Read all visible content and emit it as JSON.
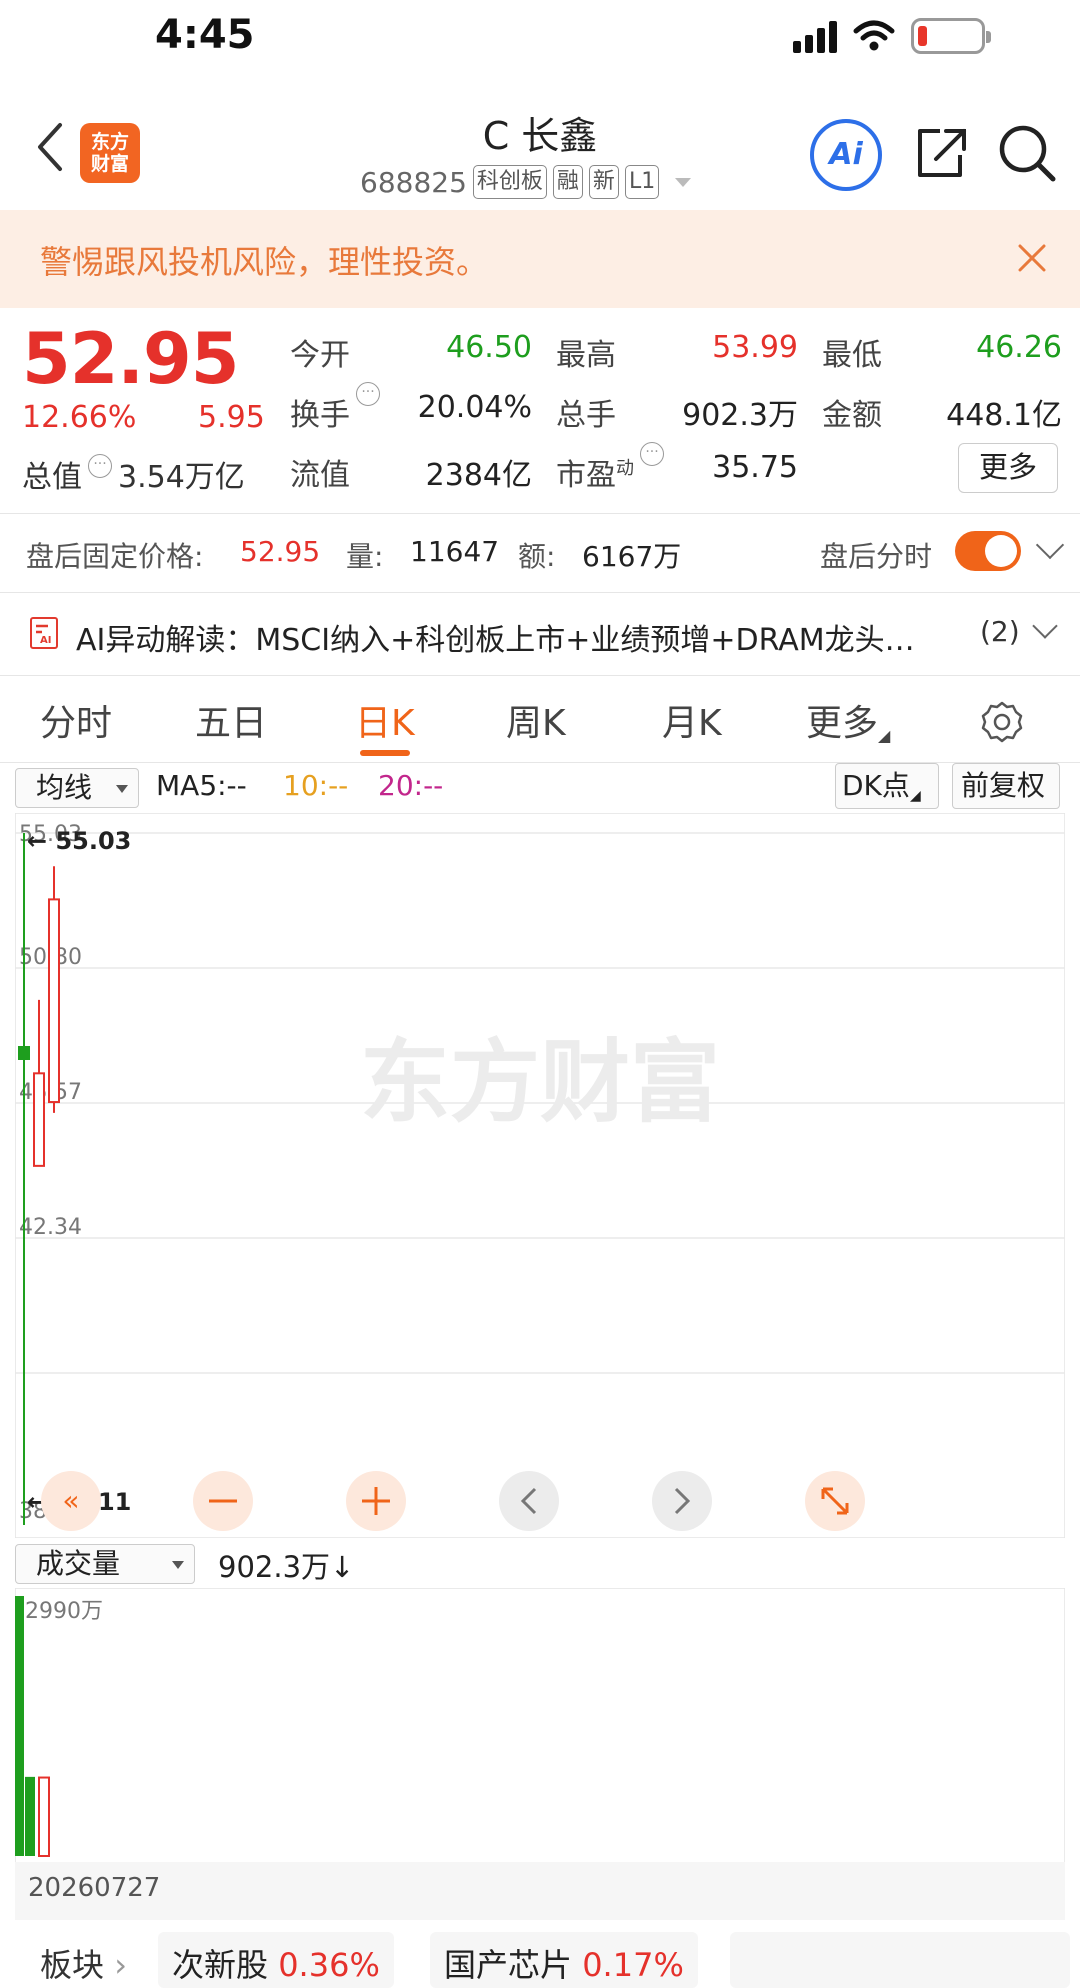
{
  "status_bar": {
    "time": "4:45"
  },
  "header": {
    "logo_text": "东方财富",
    "stock_name": "C 长鑫",
    "stock_code": "688825",
    "tags": [
      "科创板",
      "融",
      "新",
      "L1"
    ],
    "ai_label": "Ai"
  },
  "warning": {
    "text": "警惕跟风投机风险，理性投资。"
  },
  "quote": {
    "price": "52.95",
    "change_pct": "12.66%",
    "change": "5.95",
    "total_value_label": "总值",
    "total_value": "3.54万亿",
    "fields": [
      {
        "label": "今开",
        "value": "46.50",
        "color": "green"
      },
      {
        "label": "最高",
        "value": "53.99",
        "color": "red"
      },
      {
        "label": "最低",
        "value": "46.26",
        "color": "green"
      },
      {
        "label": "换手",
        "value": "20.04%",
        "color": "dark"
      },
      {
        "label": "总手",
        "value": "902.3万",
        "color": "dark"
      },
      {
        "label": "金额",
        "value": "448.1亿",
        "color": "dark"
      },
      {
        "label": "流值",
        "value": "2384亿",
        "color": "dark"
      },
      {
        "label": "市盈",
        "label_sup": "动",
        "value": "35.75",
        "color": "dark"
      }
    ],
    "more_label": "更多"
  },
  "after_hours": {
    "price_label": "盘后固定价格:",
    "price": "52.95",
    "volume_label": "量:",
    "volume": "11647",
    "amount_label": "额:",
    "amount": "6167万",
    "toggle_label": "盘后分时",
    "toggle_on": true
  },
  "ai_analysis": {
    "text": "AI异动解读：MSCI纳入+科创板上市+业绩预增+DRAM龙头…",
    "count": "(2)"
  },
  "chart_tabs": [
    {
      "label": "分时",
      "active": false
    },
    {
      "label": "五日",
      "active": false
    },
    {
      "label": "日K",
      "active": true
    },
    {
      "label": "周K",
      "active": false
    },
    {
      "label": "月K",
      "active": false
    },
    {
      "label": "更多",
      "active": false
    }
  ],
  "indicators": {
    "ma_select": "均线",
    "ma5": "MA5:--",
    "ma10": "10:--",
    "ma20": "20:--",
    "dk_label": "DK点",
    "adjust_label": "前复权",
    "ma10_color": "#e6a020",
    "ma20_color": "#c2268c"
  },
  "chart_data": {
    "type": "candlestick",
    "y_ticks": [
      "55.03",
      "50.80",
      "46.57",
      "42.34",
      "38.11"
    ],
    "ylim": [
      38.11,
      55.03
    ],
    "max_marker": "55.03",
    "min_marker": "38.11",
    "candles": [
      {
        "open": 38.11,
        "close": 38.11,
        "high": 55.03,
        "low": 38.11,
        "color": "#1e9e1e"
      },
      {
        "open": 47.5,
        "close": 44.6,
        "high": 49.8,
        "low": 44.6,
        "color": "#e5312b"
      },
      {
        "open": 46.6,
        "close": 52.95,
        "high": 53.99,
        "low": 46.26,
        "color": "#e5312b"
      }
    ],
    "watermark": "东方财富"
  },
  "volume": {
    "select_label": "成交量",
    "value": "902.3万↓",
    "max_label": "2990万",
    "bars": [
      {
        "value": 2990,
        "color": "#1e9e1e",
        "filled": true
      },
      {
        "value": 910,
        "color": "#1e9e1e",
        "filled": true
      },
      {
        "value": 902.3,
        "color": "#e5312b",
        "filled": false
      }
    ],
    "vmax": 2990
  },
  "date_label": "20260727",
  "sectors": {
    "label": "板块",
    "items": [
      {
        "name": "次新股",
        "pct": "0.36%"
      },
      {
        "name": "国产芯片",
        "pct": "0.17%"
      }
    ]
  }
}
